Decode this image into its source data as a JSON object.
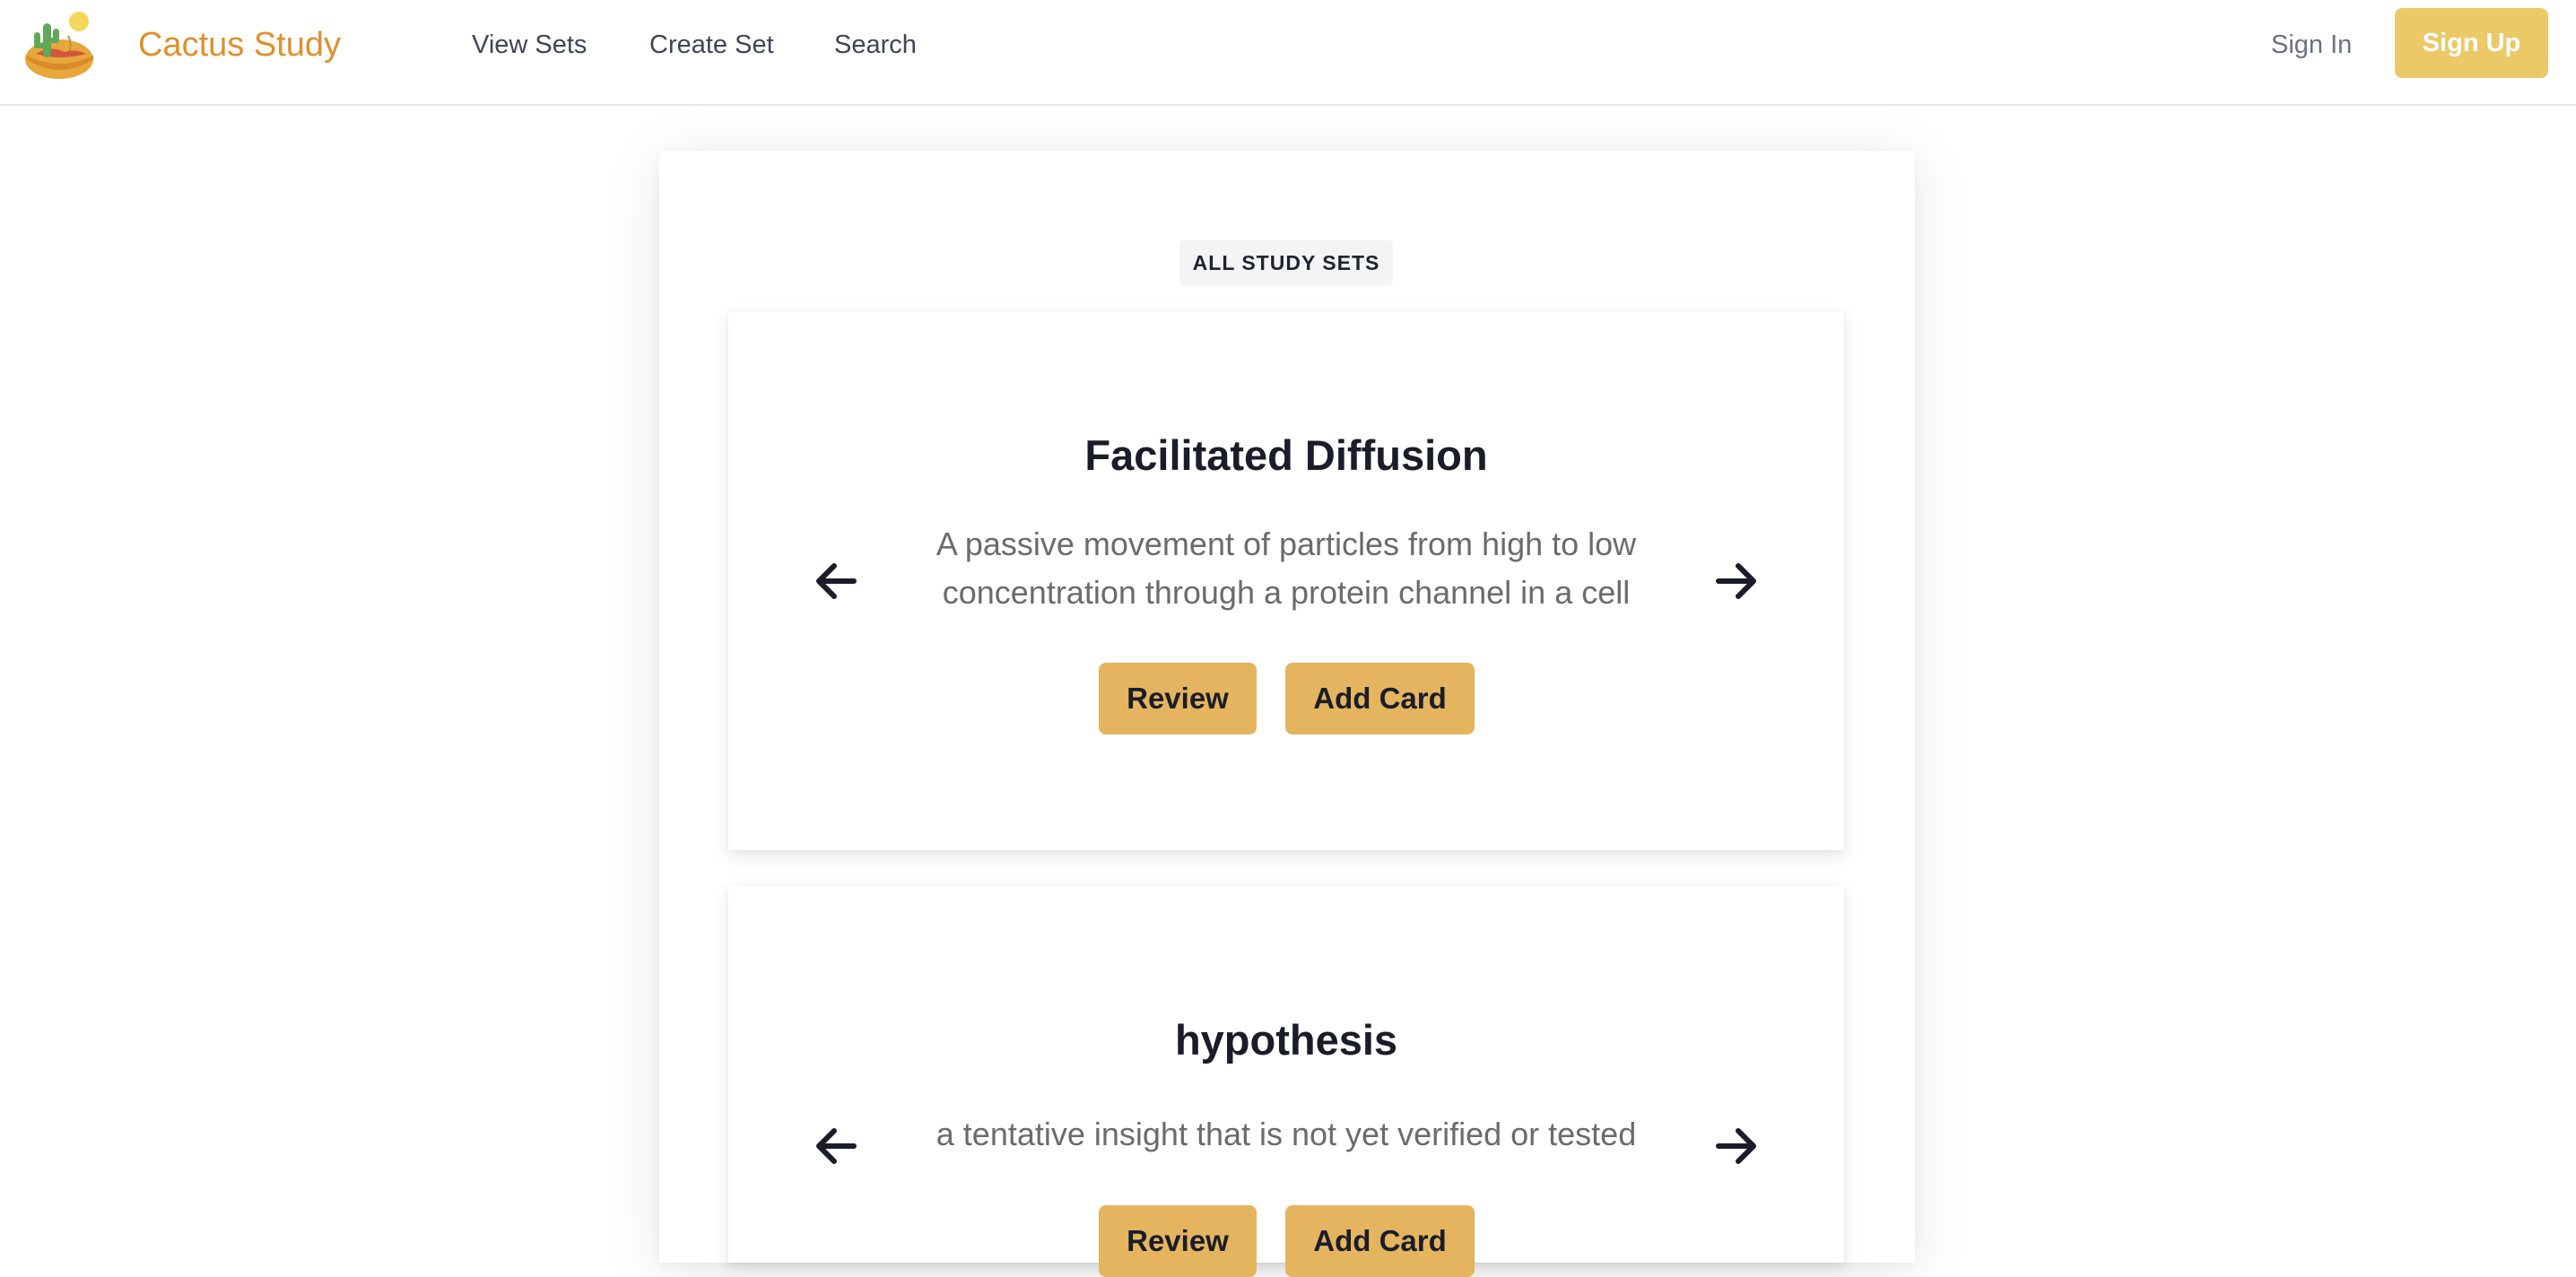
{
  "header": {
    "brand": "Cactus Study",
    "nav": {
      "view_sets": "View Sets",
      "create_set": "Create Set",
      "search": "Search"
    },
    "sign_in": "Sign In",
    "sign_up": "Sign Up"
  },
  "main": {
    "section_label": "ALL STUDY SETS",
    "cards": [
      {
        "title": "Facilitated Diffusion",
        "definition": "A passive movement of particles from high to low concentration through a protein channel in a cell",
        "review_label": "Review",
        "add_card_label": "Add Card"
      },
      {
        "title": "hypothesis",
        "definition": "a tentative insight that is not yet verified or tested",
        "review_label": "Review",
        "add_card_label": "Add Card"
      }
    ]
  },
  "icons": {
    "logo": "cactus-desert-logo",
    "prev": "arrow-left-icon",
    "next": "arrow-right-icon"
  },
  "colors": {
    "brand": "#e0902e",
    "button": "#e4b55e",
    "signup": "#ecc967",
    "text_dark": "#1a1d29",
    "text_muted": "#6b6b6b"
  }
}
